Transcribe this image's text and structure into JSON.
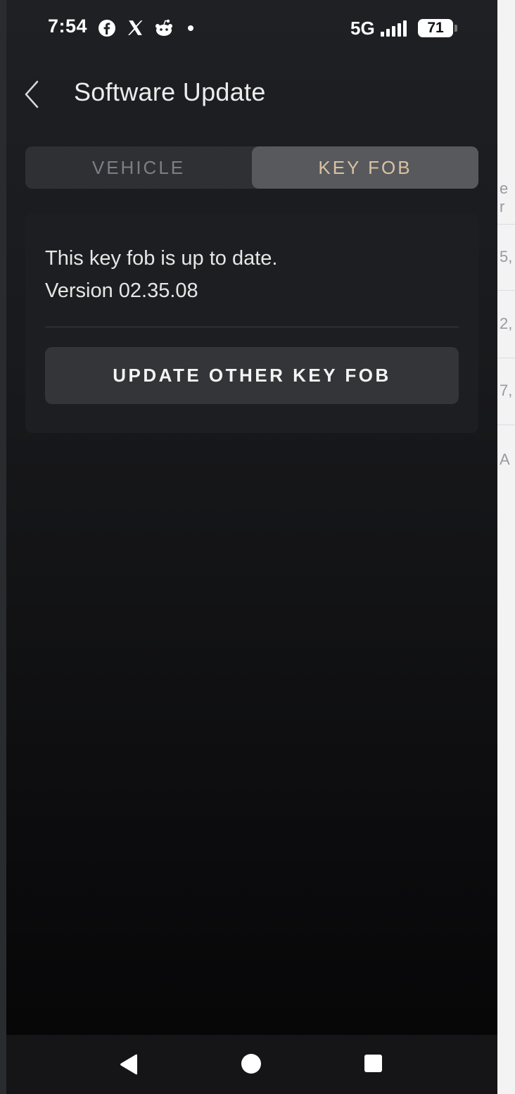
{
  "status_bar": {
    "time": "7:54",
    "network": "5G",
    "battery": "71",
    "notification_icons": [
      "facebook-icon",
      "x-icon",
      "reddit-icon",
      "dot-icon"
    ]
  },
  "header": {
    "title": "Software Update",
    "back_icon": "chevron-left-icon"
  },
  "tabs": [
    {
      "label": "VEHICLE",
      "active": false
    },
    {
      "label": "KEY FOB",
      "active": true
    }
  ],
  "card": {
    "status": "This key fob is up to date.",
    "version": "Version 02.35.08",
    "button_label": "UPDATE OTHER KEY FOB"
  },
  "background_peek": {
    "texts": [
      "e r",
      "5,",
      "2,",
      "7,",
      "A"
    ]
  },
  "nav_bar": {
    "icons": [
      "nav-back-icon",
      "nav-home-icon",
      "nav-recents-icon"
    ]
  },
  "colors": {
    "active_tab_text": "#d8c3a1",
    "active_tab_bg": "#58595d",
    "button_bg": "#343539"
  }
}
